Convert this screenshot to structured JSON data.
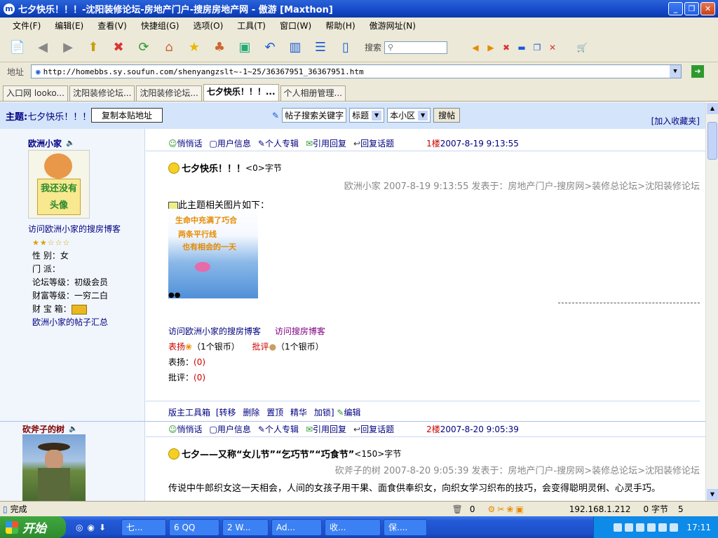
{
  "window": {
    "title": "七夕快乐！！！-沈阳装修论坛-房地产门户-搜房房地产网 - 傲游 [Maxthon]",
    "app_icon": "maxthon-icon"
  },
  "menu": [
    "文件(F)",
    "编辑(E)",
    "查看(V)",
    "快捷组(G)",
    "选项(O)",
    "工具(T)",
    "窗口(W)",
    "帮助(H)",
    "傲游网址(N)"
  ],
  "toolbar": {
    "search_label": "搜索"
  },
  "address": {
    "label": "地址",
    "url": "http://homebbs.sy.soufun.com/shenyangzslt~-1~25/36367951_36367951.htm"
  },
  "tabs": [
    "入口网 looko...",
    "沈阳装修论坛...",
    "沈阳装修论坛...",
    "七夕快乐！！！...",
    "个人相册管理..."
  ],
  "topic": {
    "label": "主题:",
    "title": "七夕快乐！！！",
    "copy_button": "复制本贴地址",
    "search_keyword": "帖子搜索关键字",
    "scope1": "标题",
    "scope2": "本小区",
    "search_button": "搜帖",
    "fav": "[加入收藏夹]"
  },
  "post1": {
    "user": "欧洲小家",
    "avatar_text": "我还没有头像",
    "blog_link": "访问欧洲小家的搜房博客",
    "gender": "性 别：女",
    "sect": "门 派：",
    "level": "论坛等级：初级会员",
    "wealth": "财富等级：一穷二白",
    "treasure": "财 宝 箱：",
    "posts_link": "欧洲小家的帖子汇总",
    "actions": [
      "悄悄话",
      "用户信息",
      "个人专辑",
      "引用回复",
      "回复话题"
    ],
    "floor": "1楼",
    "time": "2007-8-19 9:13:55",
    "title": "七夕快乐！！！",
    "size": "<0>字节",
    "meta": "欧洲小家 2007-8-19 9:13:55 发表于：房地产门户-搜房网>装修总论坛>沈阳装修论坛",
    "img_intro": "此主题相关图片如下：",
    "pic_lines": [
      "生命中充满了巧合",
      "两条平行线",
      "也有相会的一天"
    ],
    "blog1": "访问欧洲小家的搜房博客",
    "blog2": "访问搜房博客",
    "praise_label": "表扬",
    "praise_cost": "（1个银币）",
    "criticize_label": "批评",
    "criticize_cost": "（1个银币）",
    "praise_count_label": "表扬：",
    "praise_count": "(0)",
    "criticize_count_label": "批评：",
    "criticize_count": "(0)",
    "mod_label": "版主工具箱",
    "mod_tools": [
      "[转移",
      "删除",
      "置顶",
      "精华",
      "加锁]"
    ],
    "edit": "编辑"
  },
  "post2": {
    "user": "砍斧子的树",
    "actions": [
      "悄悄话",
      "用户信息",
      "个人专辑",
      "引用回复",
      "回复话题"
    ],
    "floor": "2楼",
    "time": "2007-8-20 9:05:39",
    "title": "七夕——又称“女儿节”“乞巧节”“巧食节”",
    "size": "<150>字节",
    "meta": "砍斧子的树 2007-8-20 9:05:39 发表于：房地产门户-搜房网>装修总论坛>沈阳装修论坛",
    "body": "传说中牛郎织女这一天相会，人间的女孩子用干果、面食供奉织女，向织女学习织布的技巧，会变得聪明灵俐、心灵手巧。"
  },
  "status": {
    "text": "完成",
    "count": "0",
    "ip": "192.168.1.212",
    "bytes": "0 字节",
    "num": "5"
  },
  "taskbar": {
    "start": "开始",
    "tasks": [
      "七...",
      "6 QQ",
      "2 W...",
      "Ad...",
      "收...",
      "保...."
    ],
    "clock": "17:11"
  }
}
